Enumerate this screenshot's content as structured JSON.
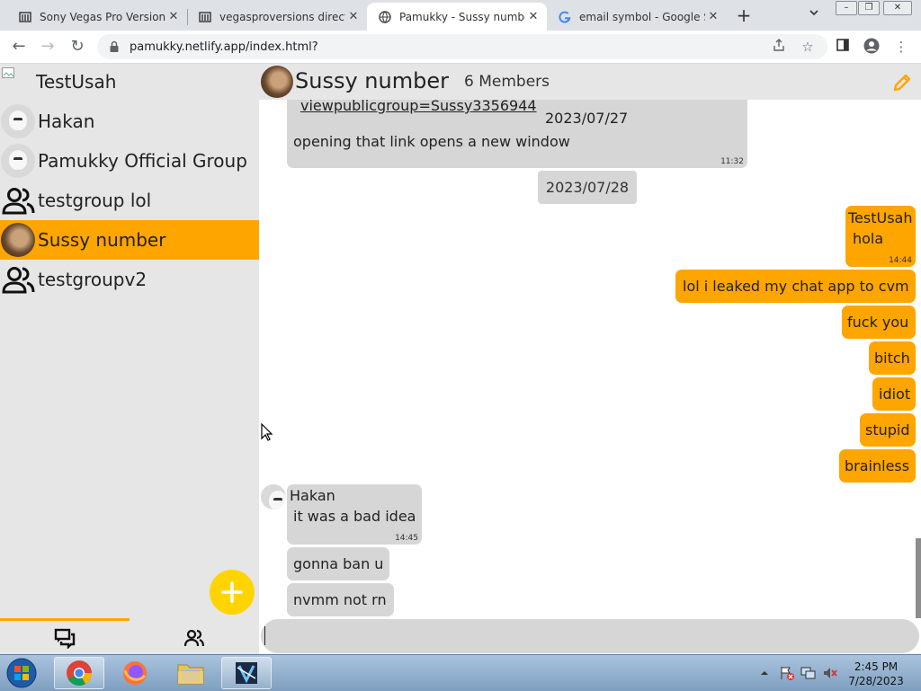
{
  "browser": {
    "tabs": [
      {
        "title": "Sony Vegas Pro Versions",
        "favicon": "building-icon",
        "active": false
      },
      {
        "title": "vegasproversions director",
        "favicon": "building-icon",
        "active": false
      },
      {
        "title": "Pamukky - Sussy number",
        "favicon": "globe-icon",
        "active": true
      },
      {
        "title": "email symbol - Google Se",
        "favicon": "google-icon",
        "active": false
      }
    ],
    "url": "pamukky.netlify.app/index.html?"
  },
  "sidebar": {
    "current_user": "TestUsah",
    "chats": [
      {
        "name": "Hakan",
        "avatar": "ghost-avatar",
        "active": false
      },
      {
        "name": "Pamukky Official Group",
        "avatar": "ghost-avatar",
        "active": false
      },
      {
        "name": "testgroup lol",
        "avatar": "group-icon",
        "active": false
      },
      {
        "name": "Sussy number",
        "avatar": "photo-avatar",
        "active": true
      },
      {
        "name": "testgroupv2",
        "avatar": "group-icon",
        "active": false
      }
    ],
    "accent_color": "#ffa500",
    "fab_color": "#ffd400"
  },
  "chat": {
    "title": "Sussy number",
    "members": "6 Members",
    "messages": {
      "m0_link": "viewpublicgroup=Sussy3356944",
      "m0_date": "2023/07/27",
      "m0_text": "opening that link opens a new window",
      "m0_time": "11:32",
      "date2": "2023/07/28",
      "m1_sender": "TestUsah",
      "m1_text": "hola",
      "m1_time": "14:44",
      "m2_text": "lol i leaked my chat app to cvm",
      "m3_text": "fuck you",
      "m4_text": "bitch",
      "m5_text": "idiot",
      "m6_text": "stupid",
      "m7_text": "brainless",
      "m8_sender": "Hakan",
      "m8_text": "it was a bad idea",
      "m8_time": "14:45",
      "m9_text": "gonna ban u",
      "m10_text": "nvmm not rn"
    },
    "input_value": ""
  },
  "taskbar": {
    "time": "2:45 PM",
    "date": "7/28/2023",
    "apps": [
      "chrome-icon",
      "firefox-icon",
      "explorer-icon",
      "vegas-icon"
    ]
  }
}
